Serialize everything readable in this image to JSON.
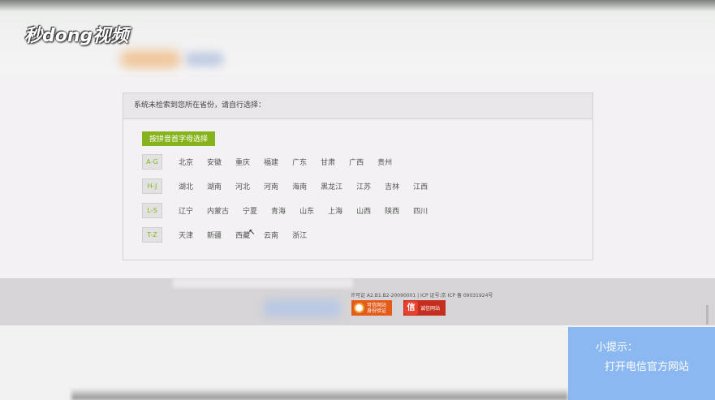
{
  "overlay": {
    "logo": "秒dong视频"
  },
  "panel": {
    "header": "系统未检索到您所在省份，请自行选择：",
    "pinyin_button": "按拼音首字母选择",
    "groups": [
      {
        "label": "A-G",
        "provinces": [
          "北京",
          "安徽",
          "重庆",
          "福建",
          "广东",
          "甘肃",
          "广西",
          "贵州"
        ]
      },
      {
        "label": "H-J",
        "provinces": [
          "湖北",
          "湖南",
          "河北",
          "河南",
          "海南",
          "黑龙江",
          "江苏",
          "吉林",
          "江西"
        ]
      },
      {
        "label": "L-S",
        "provinces": [
          "辽宁",
          "内蒙古",
          "宁夏",
          "青海",
          "山东",
          "上海",
          "山西",
          "陕西",
          "四川"
        ]
      },
      {
        "label": "T-Z",
        "provinces": [
          "天津",
          "新疆",
          "西藏",
          "云南",
          "浙江"
        ]
      }
    ]
  },
  "footer": {
    "license": "许可证 A2.B1.B2-20090001 | ICP 证号:京 ICP 备 09031924号",
    "badge1_line1": "可信网站",
    "badge1_line2": "身份验证",
    "badge2_icon": "信",
    "badge2_text": "诚信网站"
  },
  "tip": {
    "title": "小提示：",
    "text": "打开电信官方网站"
  },
  "colors": {
    "accent_green": "#86b31c",
    "tip_blue": "#8cb8f1"
  }
}
